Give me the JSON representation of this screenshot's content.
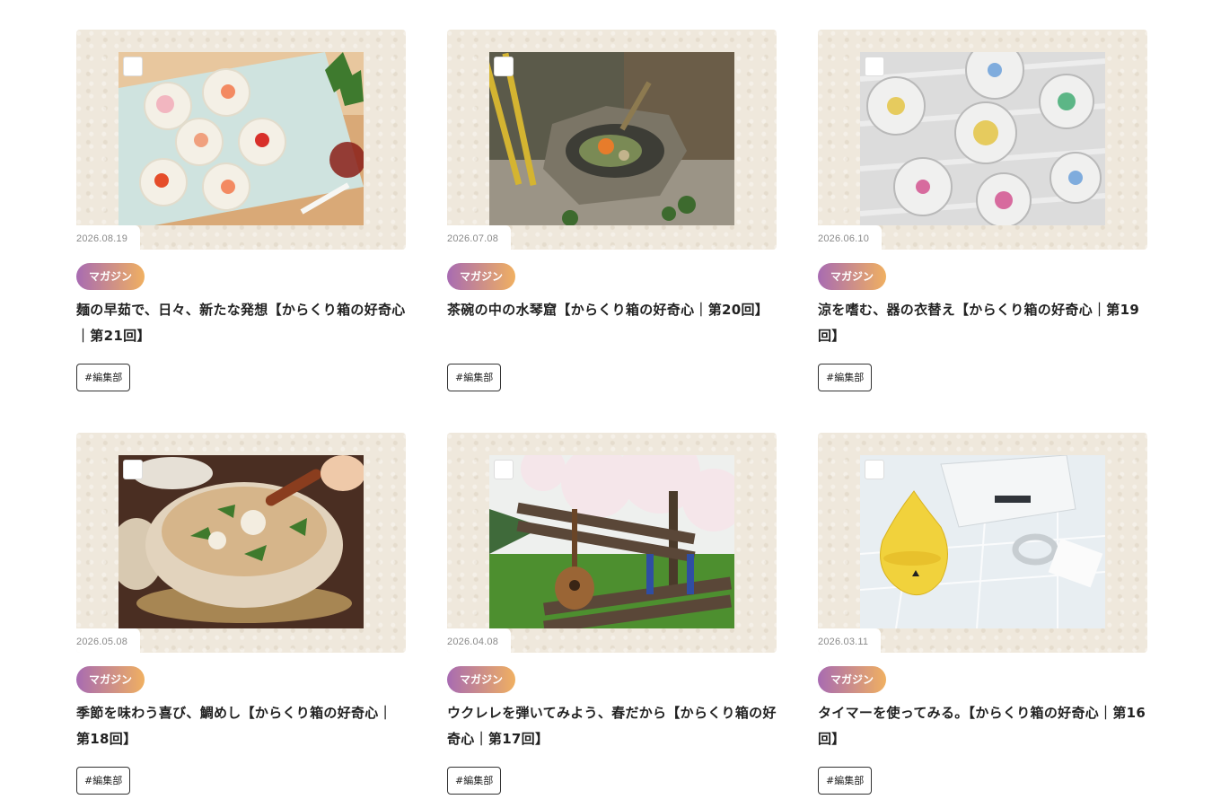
{
  "articles": [
    {
      "date": "2026.08.19",
      "category": "マガジン",
      "title": "麺の早茹で、日々、新たな発想【からくり箱の好奇心｜第21回】",
      "tag": "#編集部",
      "image": "somen-noodles-platter"
    },
    {
      "date": "2026.07.08",
      "category": "マガジン",
      "title": "茶碗の中の水琴窟【からくり箱の好奇心｜第20回】",
      "tag": "#編集部",
      "image": "stone-water-basin-garden"
    },
    {
      "date": "2026.06.10",
      "category": "マガジン",
      "title": "涼を嗜む、器の衣替え【からくり箱の好奇心｜第19回】",
      "tag": "#編集部",
      "image": "colorful-glass-cups"
    },
    {
      "date": "2026.05.08",
      "category": "マガジン",
      "title": "季節を味わう喜び、鯛めし【からくり箱の好奇心｜第18回】",
      "tag": "#編集部",
      "image": "clay-pot-rice"
    },
    {
      "date": "2026.04.08",
      "category": "マガジン",
      "title": "ウクレレを弾いてみよう、春だから【からくり箱の好奇心｜第17回】",
      "tag": "#編集部",
      "image": "ukulele-on-bench-cherry-blossom"
    },
    {
      "date": "2026.03.11",
      "category": "マガジン",
      "title": "タイマーを使ってみる。【からくり箱の好奇心｜第16回】",
      "tag": "#編集部",
      "image": "yellow-kitchen-timer"
    }
  ]
}
